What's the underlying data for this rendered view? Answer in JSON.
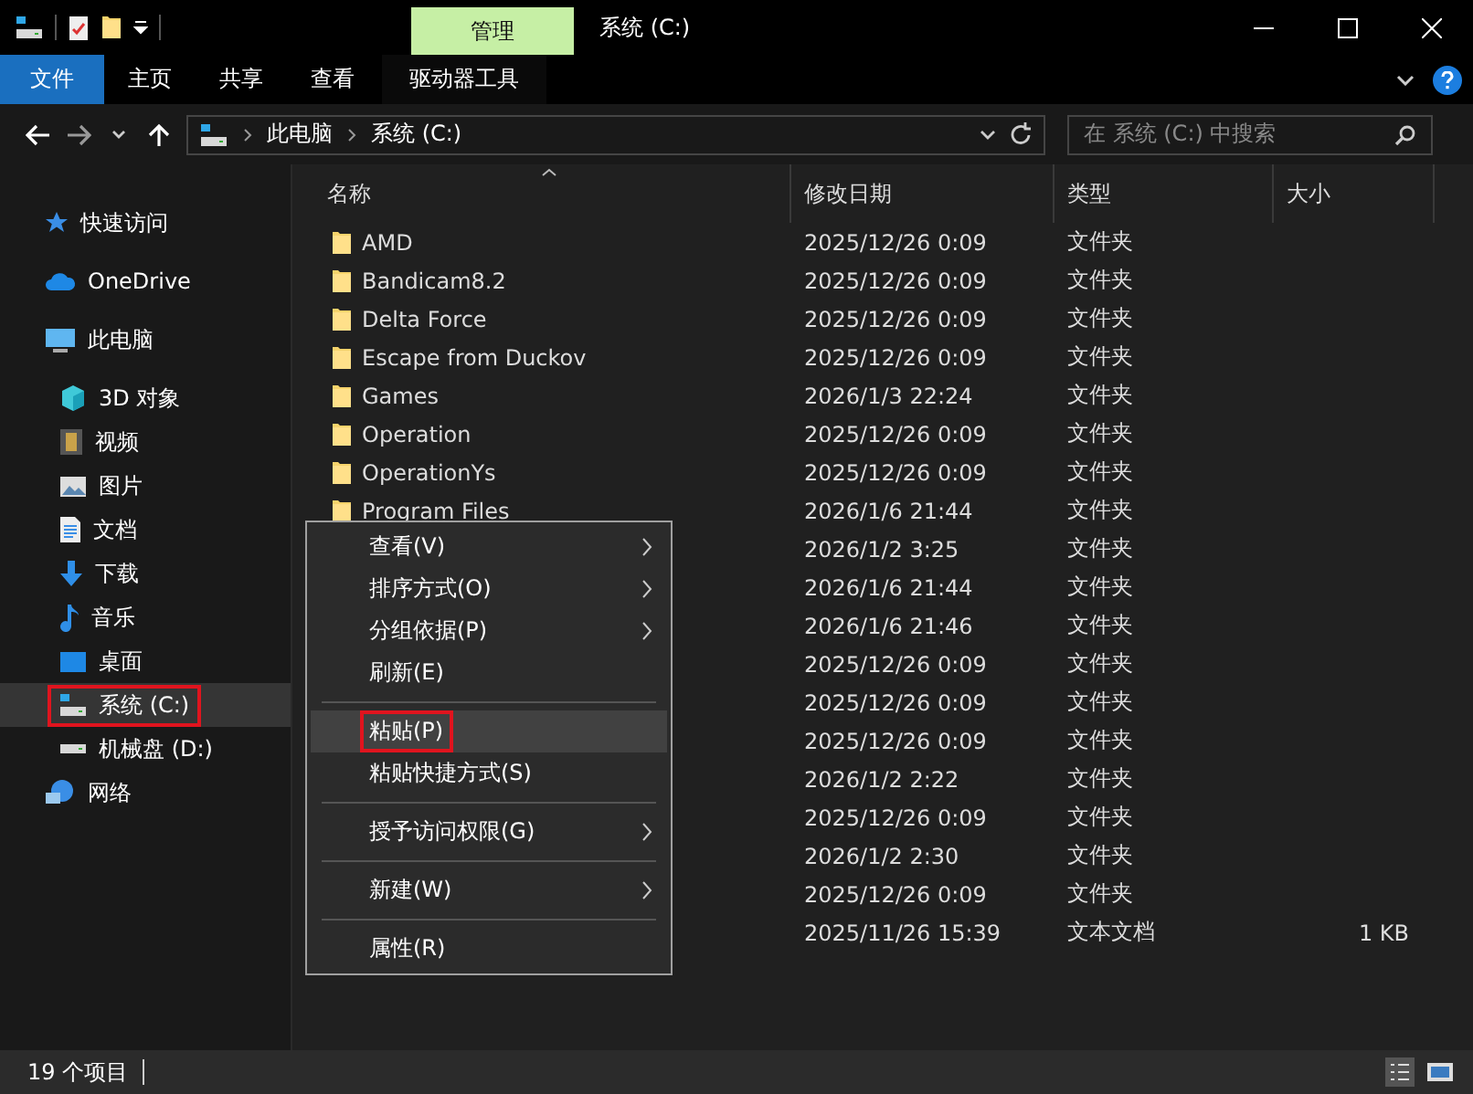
{
  "window": {
    "title": "系统 (C:)",
    "context_tab": "管理"
  },
  "ribbon_tabs": [
    {
      "label": "文件",
      "kind": "file"
    },
    {
      "label": "主页",
      "kind": "tab"
    },
    {
      "label": "共享",
      "kind": "tab"
    },
    {
      "label": "查看",
      "kind": "tab"
    },
    {
      "label": "驱动器工具",
      "kind": "context"
    }
  ],
  "address": {
    "path": [
      "此电脑",
      "系统 (C:)"
    ],
    "search_placeholder": "在 系统 (C:) 中搜索"
  },
  "sidebar": [
    {
      "label": "快速访问",
      "selected": false,
      "highlighted": false
    },
    {
      "label": "OneDrive",
      "selected": false,
      "highlighted": false
    },
    {
      "label": "此电脑",
      "selected": false,
      "highlighted": false,
      "children": [
        {
          "label": "3D 对象",
          "selected": false,
          "highlighted": false
        },
        {
          "label": "视频",
          "selected": false,
          "highlighted": false
        },
        {
          "label": "图片",
          "selected": false,
          "highlighted": false
        },
        {
          "label": "文档",
          "selected": false,
          "highlighted": false
        },
        {
          "label": "下载",
          "selected": false,
          "highlighted": false
        },
        {
          "label": "音乐",
          "selected": false,
          "highlighted": false
        },
        {
          "label": "桌面",
          "selected": false,
          "highlighted": false
        },
        {
          "label": "系统 (C:)",
          "selected": true,
          "highlighted": true
        },
        {
          "label": "机械盘 (D:)",
          "selected": false,
          "highlighted": false
        }
      ]
    },
    {
      "label": "网络",
      "selected": false,
      "highlighted": false
    }
  ],
  "table": {
    "columns": [
      "名称",
      "修改日期",
      "类型",
      "大小"
    ],
    "rows": [
      {
        "name": "AMD",
        "date": "2025/12/26 0:09",
        "type": "文件夹"
      },
      {
        "name": "Bandicam8.2",
        "date": "2025/12/26 0:09",
        "type": "文件夹"
      },
      {
        "name": "Delta Force",
        "date": "2025/12/26 0:09",
        "type": "文件夹"
      },
      {
        "name": "Escape from Duckov",
        "date": "2025/12/26 0:09",
        "type": "文件夹"
      },
      {
        "name": "Games",
        "date": "2026/1/3 22:24",
        "type": "文件夹"
      },
      {
        "name": "Operation",
        "date": "2025/12/26 0:09",
        "type": "文件夹"
      },
      {
        "name": "OperationYs",
        "date": "2025/12/26 0:09",
        "type": "文件夹"
      },
      {
        "name": "Program Files",
        "date": "2026/1/6 21:44",
        "type": "文件夹"
      },
      {
        "date": "2026/1/2 3:25",
        "type": "文件夹"
      },
      {
        "date": "2026/1/6 21:44",
        "type": "文件夹"
      },
      {
        "date": "2026/1/6 21:46",
        "type": "文件夹"
      },
      {
        "date": "2025/12/26 0:09",
        "type": "文件夹"
      },
      {
        "date": "2025/12/26 0:09",
        "type": "文件夹"
      },
      {
        "date": "2025/12/26 0:09",
        "type": "文件夹"
      },
      {
        "date": "2026/1/2 2:22",
        "type": "文件夹"
      },
      {
        "date": "2025/12/26 0:09",
        "type": "文件夹"
      },
      {
        "date": "2026/1/2 2:30",
        "type": "文件夹"
      },
      {
        "date": "2025/12/26 0:09",
        "type": "文件夹"
      },
      {
        "date": "2025/11/26 15:39",
        "type": "文本文档",
        "size": "1 KB"
      }
    ]
  },
  "context_menu": [
    [
      {
        "label": "查看(V)",
        "submenu": true,
        "hovered": false,
        "highlighted": false
      },
      {
        "label": "排序方式(O)",
        "submenu": true,
        "hovered": false,
        "highlighted": false
      },
      {
        "label": "分组依据(P)",
        "submenu": true,
        "hovered": false,
        "highlighted": false
      },
      {
        "label": "刷新(E)",
        "submenu": false,
        "hovered": false,
        "highlighted": false
      }
    ],
    [
      {
        "label": "粘贴(P)",
        "submenu": false,
        "hovered": true,
        "highlighted": true
      },
      {
        "label": "粘贴快捷方式(S)",
        "submenu": false,
        "hovered": false,
        "highlighted": false
      }
    ],
    [
      {
        "label": "授予访问权限(G)",
        "submenu": true,
        "hovered": false,
        "highlighted": false
      }
    ],
    [
      {
        "label": "新建(W)",
        "submenu": true,
        "hovered": false,
        "highlighted": false
      }
    ],
    [
      {
        "label": "属性(R)",
        "submenu": false,
        "hovered": false,
        "highlighted": false
      }
    ]
  ],
  "status_bar": {
    "count": "19 个项目"
  }
}
